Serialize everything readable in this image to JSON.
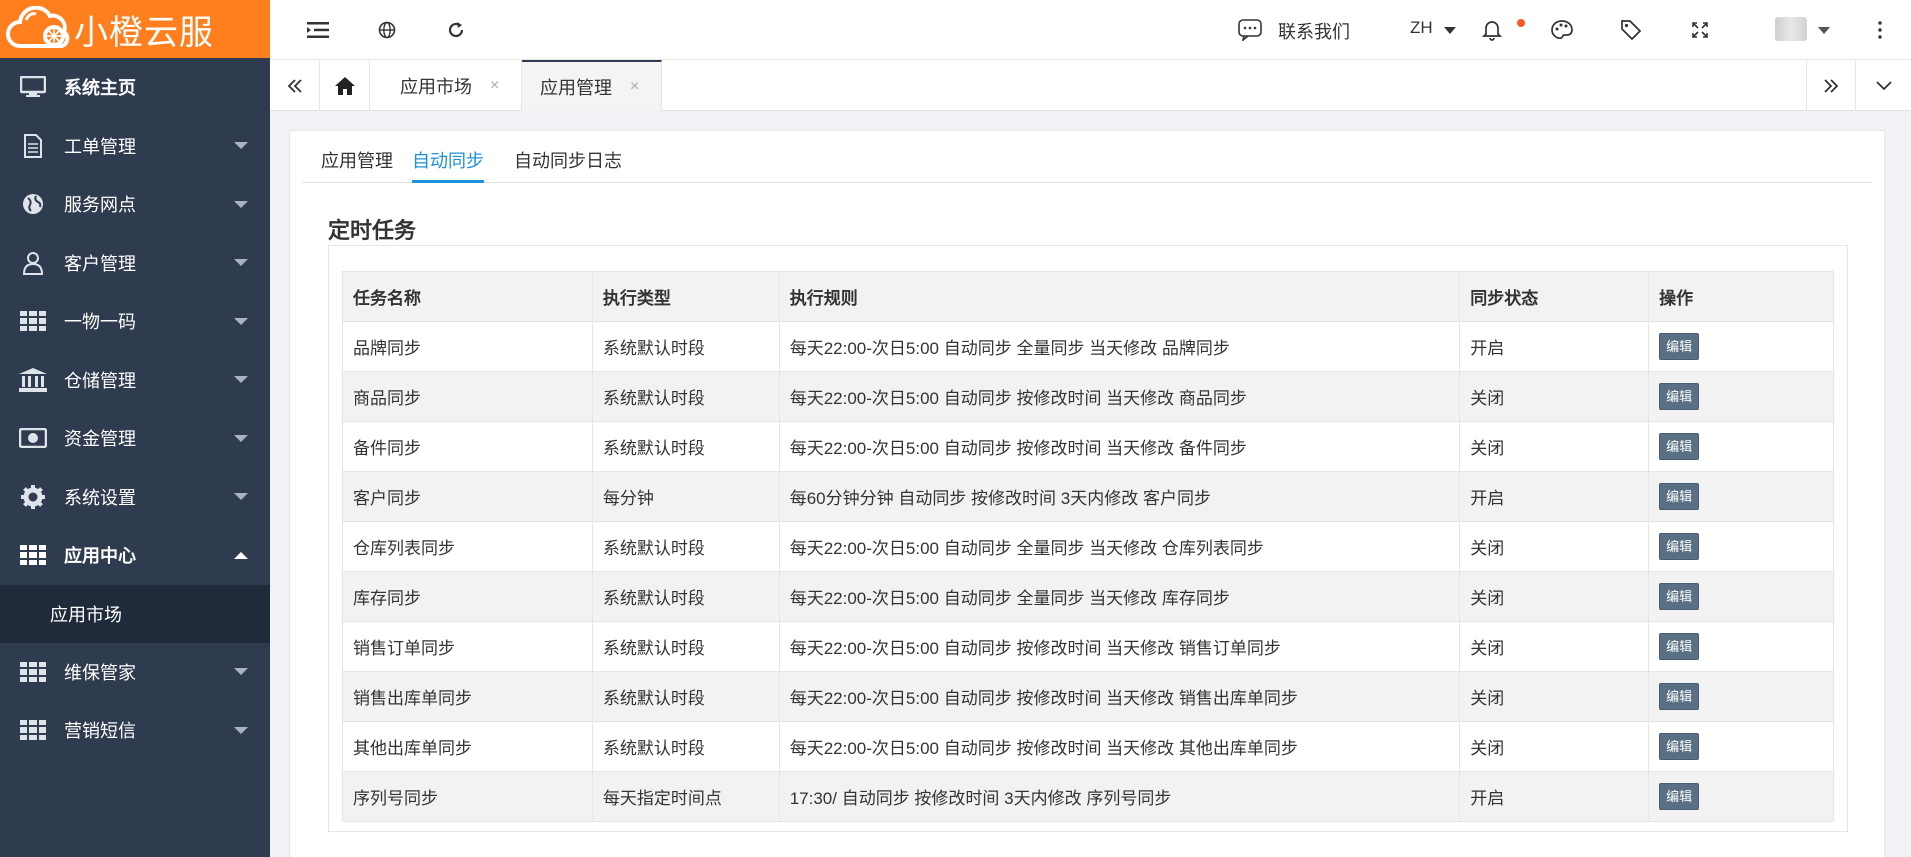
{
  "brand": {
    "name": "小橙云服",
    "color": "#ff7f1f"
  },
  "sidebar": {
    "items": [
      {
        "label": "系统主页",
        "icon": "monitor-icon",
        "bold": true
      },
      {
        "label": "工单管理",
        "icon": "document-icon"
      },
      {
        "label": "服务网点",
        "icon": "globe-icon"
      },
      {
        "label": "客户管理",
        "icon": "user-icon"
      },
      {
        "label": "一物一码",
        "icon": "grid-icon"
      },
      {
        "label": "仓储管理",
        "icon": "bank-icon"
      },
      {
        "label": "资金管理",
        "icon": "money-icon"
      },
      {
        "label": "系统设置",
        "icon": "gear-icon"
      },
      {
        "label": "应用中心",
        "icon": "grid-icon",
        "expanded": true
      },
      {
        "label": "维保管家",
        "icon": "grid-icon"
      },
      {
        "label": "营销短信",
        "icon": "grid-icon"
      }
    ],
    "sub_item": "应用市场"
  },
  "topbar": {
    "contact": "联系我们",
    "lang": "ZH"
  },
  "tabs": {
    "items": [
      {
        "label": "应用市场",
        "close": "×"
      },
      {
        "label": "应用管理",
        "close": "×"
      }
    ]
  },
  "subtabs": [
    "应用管理",
    "自动同步",
    "自动同步日志"
  ],
  "section_title": "定时任务",
  "table": {
    "headers": [
      "任务名称",
      "执行类型",
      "执行规则",
      "同步状态",
      "操作"
    ],
    "rows": [
      [
        "品牌同步",
        "系统默认时段",
        "每天22:00-次日5:00 自动同步 全量同步 当天修改 品牌同步",
        "开启",
        "编辑"
      ],
      [
        "商品同步",
        "系统默认时段",
        "每天22:00-次日5:00 自动同步 按修改时间 当天修改 商品同步",
        "关闭",
        "编辑"
      ],
      [
        "备件同步",
        "系统默认时段",
        "每天22:00-次日5:00 自动同步 按修改时间 当天修改 备件同步",
        "关闭",
        "编辑"
      ],
      [
        "客户同步",
        "每分钟",
        "每60分钟分钟 自动同步 按修改时间 3天内修改 客户同步",
        "开启",
        "编辑"
      ],
      [
        "仓库列表同步",
        "系统默认时段",
        "每天22:00-次日5:00 自动同步 全量同步 当天修改 仓库列表同步",
        "关闭",
        "编辑"
      ],
      [
        "库存同步",
        "系统默认时段",
        "每天22:00-次日5:00 自动同步 全量同步 当天修改 库存同步",
        "关闭",
        "编辑"
      ],
      [
        "销售订单同步",
        "系统默认时段",
        "每天22:00-次日5:00 自动同步 按修改时间 当天修改 销售订单同步",
        "关闭",
        "编辑"
      ],
      [
        "销售出库单同步",
        "系统默认时段",
        "每天22:00-次日5:00 自动同步 按修改时间 当天修改 销售出库单同步",
        "关闭",
        "编辑"
      ],
      [
        "其他出库单同步",
        "系统默认时段",
        "每天22:00-次日5:00 自动同步 按修改时间 当天修改 其他出库单同步",
        "关闭",
        "编辑"
      ],
      [
        "序列号同步",
        "每天指定时间点",
        "17:30/ 自动同步 按修改时间 3天内修改 序列号同步",
        "开启",
        "编辑"
      ]
    ]
  }
}
